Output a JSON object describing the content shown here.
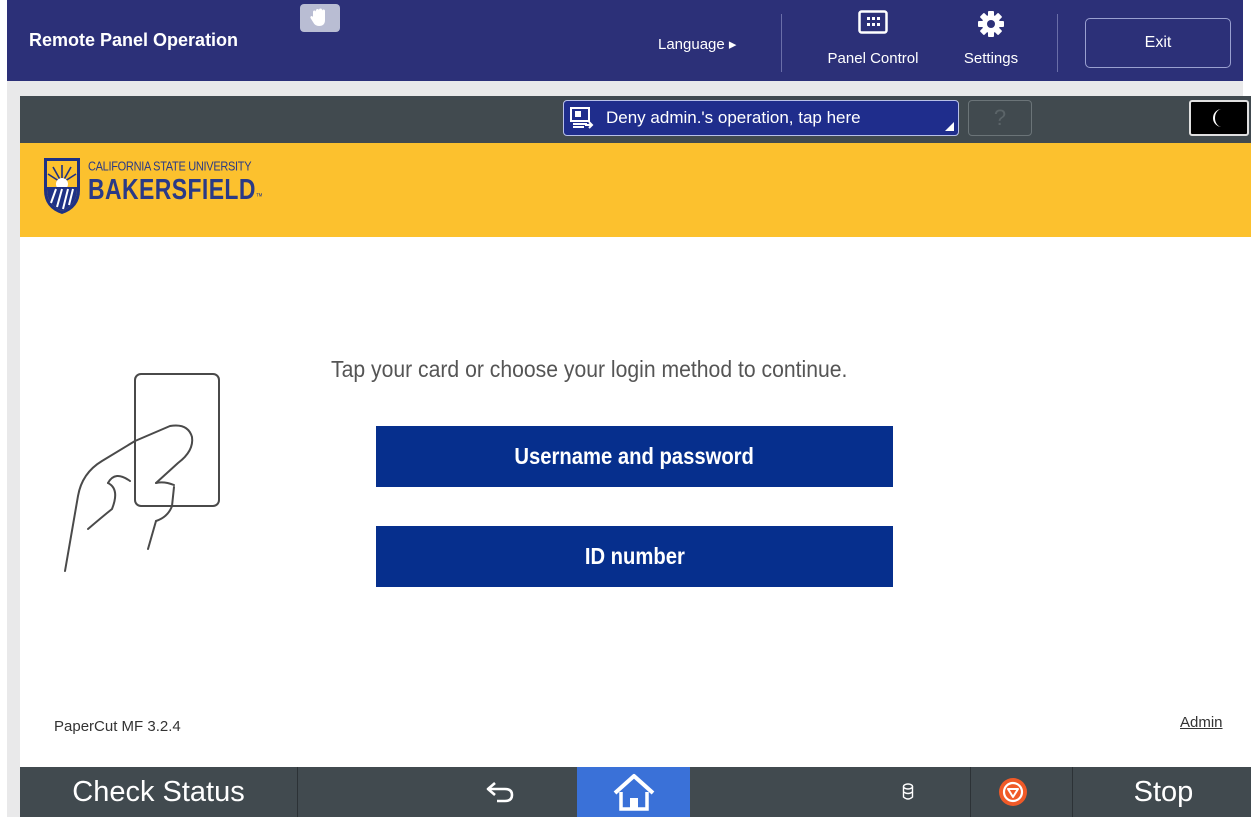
{
  "header": {
    "title": "Remote Panel Operation",
    "hand_icon": "hand-icon",
    "language_label": "Language ▸",
    "panel_control_label": "Panel Control",
    "settings_label": "Settings",
    "exit_label": "Exit",
    "background_color": "#2c3078"
  },
  "status_bar": {
    "deny_label": "Deny admin.'s operation, tap here",
    "help_label": "?",
    "moon_icon": "moon-icon"
  },
  "brand": {
    "line1": "CALIFORNIA STATE UNIVERSITY",
    "line2": "BAKERSFIELD",
    "trademark": "™",
    "bar_color": "#fcc12e",
    "text_color": "#2a3a86"
  },
  "login": {
    "prompt": "Tap your card or choose your login method to continue.",
    "options": [
      {
        "label": "Username and password"
      },
      {
        "label": "ID number"
      }
    ],
    "button_color": "#062f8d"
  },
  "footer": {
    "version": "PaperCut MF 3.2.4",
    "admin_link": "Admin"
  },
  "bottom_bar": {
    "check_status_label": "Check Status",
    "stop_label": "Stop",
    "home_color": "#3a71d8",
    "stop_color": "#f05a28"
  }
}
